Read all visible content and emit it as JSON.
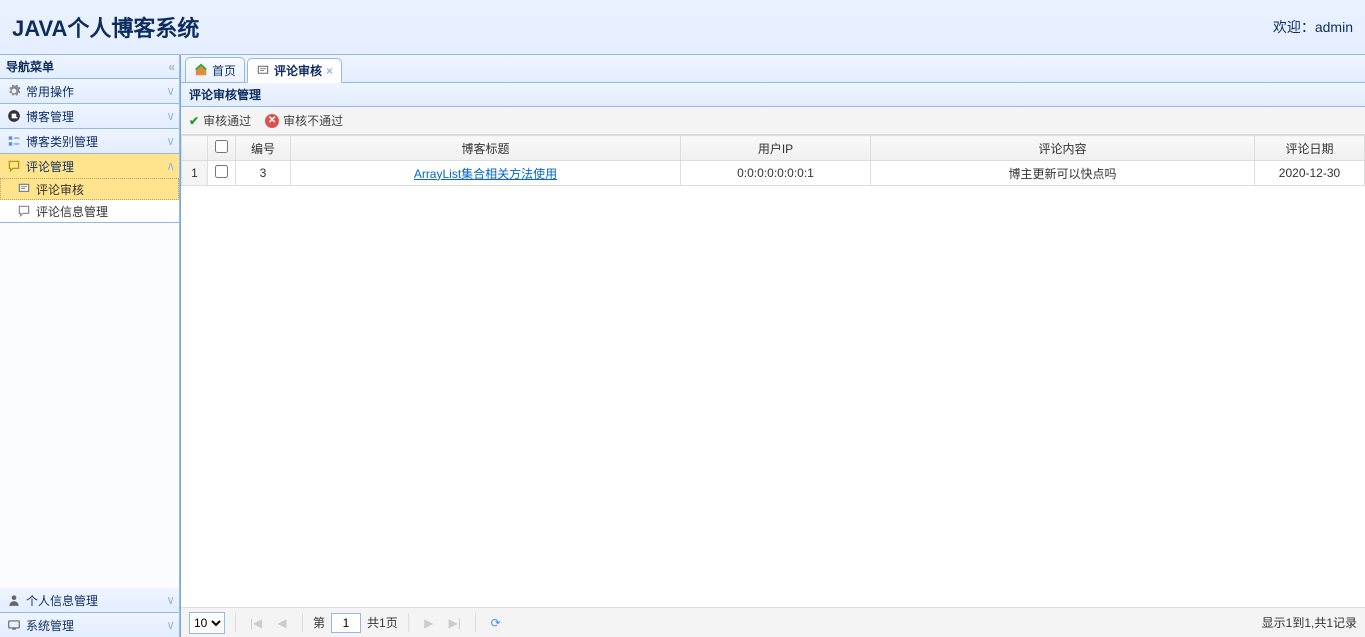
{
  "header": {
    "title": "JAVA个人博客系统",
    "welcome_prefix": "欢迎：",
    "user": "admin"
  },
  "sidebar": {
    "title": "导航菜单",
    "panels": [
      {
        "label": "常用操作",
        "icon": "gear"
      },
      {
        "label": "博客管理",
        "icon": "blog"
      },
      {
        "label": "博客类别管理",
        "icon": "category"
      },
      {
        "label": "评论管理",
        "icon": "comment",
        "active": true,
        "items": [
          {
            "label": "评论审核",
            "icon": "review",
            "selected": true
          },
          {
            "label": "评论信息管理",
            "icon": "manage"
          }
        ]
      },
      {
        "label": "个人信息管理",
        "icon": "user"
      },
      {
        "label": "系统管理",
        "icon": "system"
      }
    ]
  },
  "tabs": [
    {
      "label": "首页",
      "icon": "home",
      "closable": false
    },
    {
      "label": "评论审核",
      "icon": "review",
      "closable": true,
      "active": true
    }
  ],
  "panel": {
    "title": "评论审核管理"
  },
  "toolbar": {
    "approve": "审核通过",
    "reject": "审核不通过"
  },
  "grid": {
    "columns": [
      "编号",
      "博客标题",
      "用户IP",
      "评论内容",
      "评论日期"
    ],
    "rows": [
      {
        "rownum": "1",
        "id": "3",
        "title": "ArrayList集合相关方法使用",
        "ip": "0:0:0:0:0:0:0:1",
        "content": "博主更新可以快点吗",
        "date": "2020-12-30"
      }
    ]
  },
  "pager": {
    "page_size": "10",
    "page_label_prefix": "第",
    "page": "1",
    "total_pages_label": "共1页",
    "info": "显示1到1,共1记录"
  }
}
